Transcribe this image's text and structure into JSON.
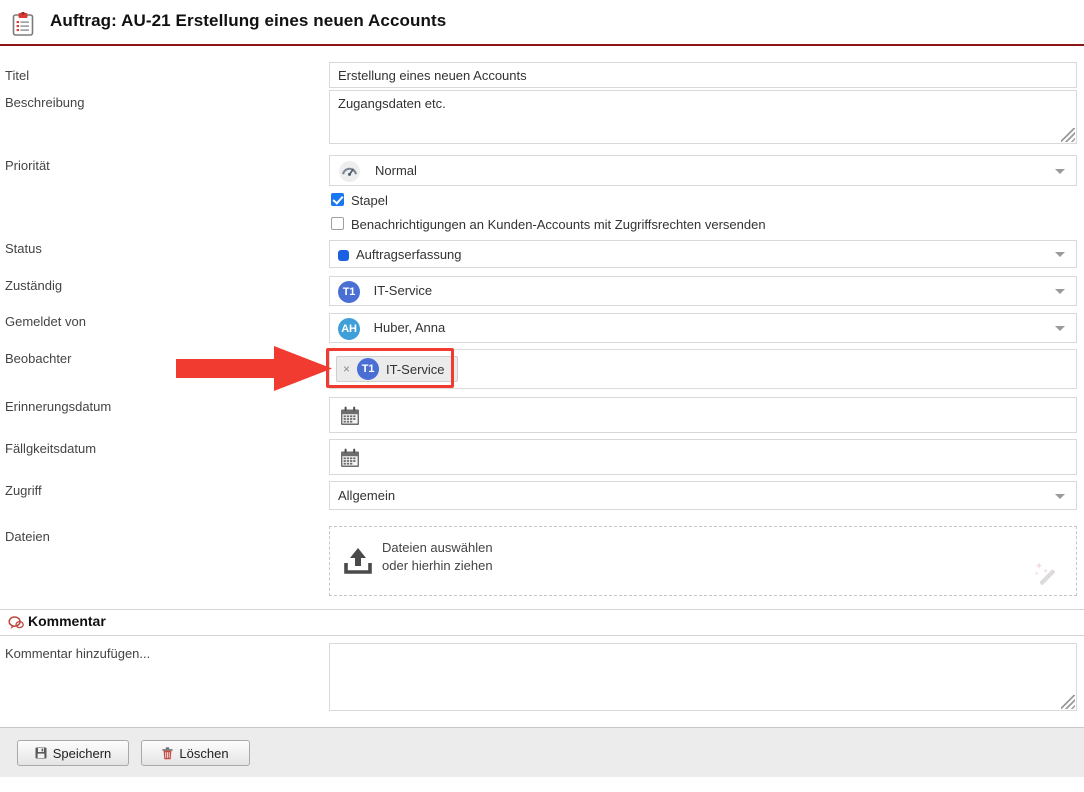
{
  "header": {
    "icon": "clipboard-icon",
    "title": "Auftrag: AU-21 Erstellung eines neuen Accounts",
    "accent_color": "#8c1515"
  },
  "form": {
    "rows": [
      {
        "label": "Titel",
        "value": "Erstellung eines neuen Accounts"
      },
      {
        "label": "Beschreibung",
        "value": "Zugangsdaten etc."
      },
      {
        "label": "Priorität",
        "value": "Normal",
        "icon": "gauge-icon"
      },
      {
        "label": "Status",
        "value": "Auftragserfassung",
        "dot_color": "#1b5fe3"
      },
      {
        "label": "Zuständig",
        "value": "IT-Service",
        "avatar": "T1"
      },
      {
        "label": "Gemeldet von",
        "value": "Huber, Anna",
        "avatar": "AH"
      },
      {
        "label": "Beobachter",
        "value": "IT-Service",
        "avatar": "T1",
        "remove": "×"
      },
      {
        "label": "Erinnerungsdatum",
        "value": "",
        "icon": "calendar-icon"
      },
      {
        "label": "Fällgkeitsdatum",
        "value": "",
        "icon": "calendar-icon"
      },
      {
        "label": "Zugriff",
        "value": "Allgemein"
      },
      {
        "label": "Dateien",
        "value": ""
      }
    ],
    "checkboxes": [
      {
        "label": "Stapel",
        "checked": true
      },
      {
        "label": "Benachrichtigungen an Kunden-Accounts mit Zugriffsrechten versenden",
        "checked": false
      }
    ],
    "upload": {
      "line1": "Dateien auswählen",
      "line2": "oder hierhin ziehen",
      "icon": "upload-icon",
      "tool_icon": "magic-wand-icon"
    }
  },
  "comment": {
    "section_title": "Kommentar",
    "section_icon": "speech-bubble-icon",
    "label": "Kommentar hinzufügen...",
    "value": ""
  },
  "footer": {
    "save_label": "Speichern",
    "save_icon": "floppy-disk-icon",
    "delete_label": "Löschen",
    "delete_icon": "trash-icon"
  },
  "annotation": {
    "type": "red-arrow-highlight",
    "target": "Beobachter",
    "color": "#f23b30"
  }
}
